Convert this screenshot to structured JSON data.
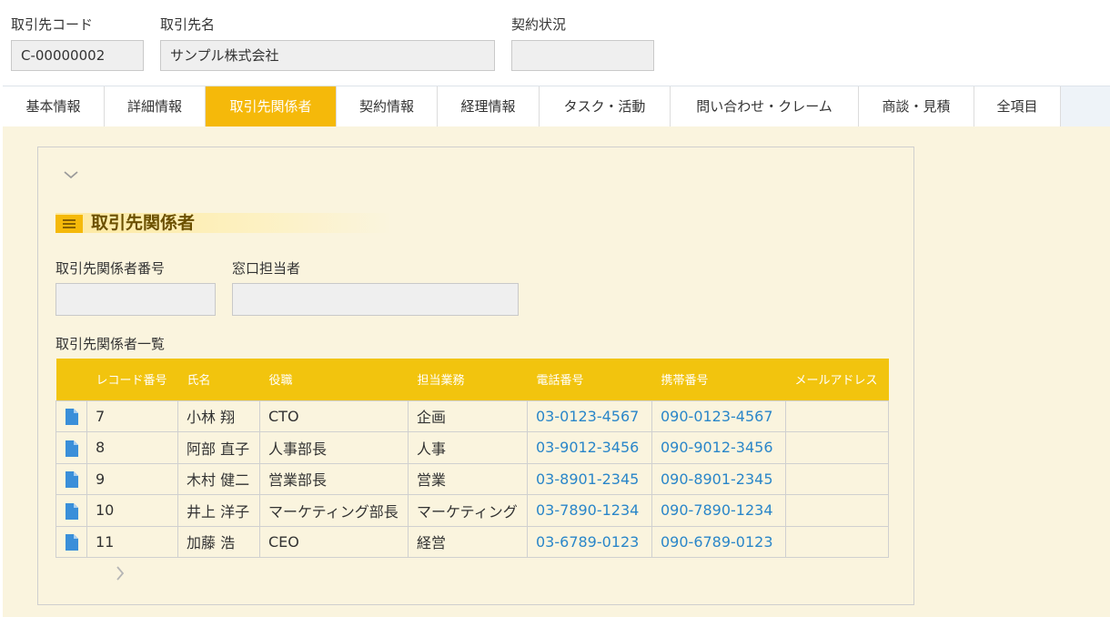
{
  "header": {
    "code_label": "取引先コード",
    "code_value": "C-00000002",
    "name_label": "取引先名",
    "name_value": "サンプル株式会社",
    "status_label": "契約状況",
    "status_value": ""
  },
  "tabs": [
    {
      "label": "基本情報"
    },
    {
      "label": "詳細情報"
    },
    {
      "label": "取引先関係者"
    },
    {
      "label": "契約情報"
    },
    {
      "label": "経理情報"
    },
    {
      "label": "タスク・活動"
    },
    {
      "label": "問い合わせ・クレーム"
    },
    {
      "label": "商談・見積"
    },
    {
      "label": "全項目"
    }
  ],
  "active_tab": "取引先関係者",
  "section": {
    "title": "取引先関係者",
    "contact_no_label": "取引先関係者番号",
    "contact_no_value": "",
    "window_label": "窓口担当者",
    "window_value": "",
    "list_label": "取引先関係者一覧"
  },
  "table": {
    "columns": [
      "",
      "レコード番号",
      "氏名",
      "役職",
      "担当業務",
      "電話番号",
      "携帯番号",
      "メールアドレス"
    ],
    "rows": [
      {
        "record": "7",
        "name": "小林 翔",
        "title": "CTO",
        "duty": "企画",
        "phone": "03-0123-4567",
        "mobile": "090-0123-4567",
        "email": ""
      },
      {
        "record": "8",
        "name": "阿部 直子",
        "title": "人事部長",
        "duty": "人事",
        "phone": "03-9012-3456",
        "mobile": "090-9012-3456",
        "email": ""
      },
      {
        "record": "9",
        "name": "木村 健二",
        "title": "営業部長",
        "duty": "営業",
        "phone": "03-8901-2345",
        "mobile": "090-8901-2345",
        "email": ""
      },
      {
        "record": "10",
        "name": "井上 洋子",
        "title": "マーケティング部長",
        "duty": "マーケティング",
        "phone": "03-7890-1234",
        "mobile": "090-7890-1234",
        "email": ""
      },
      {
        "record": "11",
        "name": "加藤 浩",
        "title": "CEO",
        "duty": "経営",
        "phone": "03-6789-0123",
        "mobile": "090-6789-0123",
        "email": ""
      }
    ]
  },
  "icons": {
    "collapse": "chevron-down-icon",
    "section": "list-icon",
    "row": "document-icon",
    "next": "chevron-right-icon"
  },
  "colors": {
    "accent": "#f5b90a",
    "header_row": "#f2c40e",
    "link": "#2a86c9",
    "panel_bg": "#faf4de",
    "row_icon": "#3a8fd9"
  }
}
